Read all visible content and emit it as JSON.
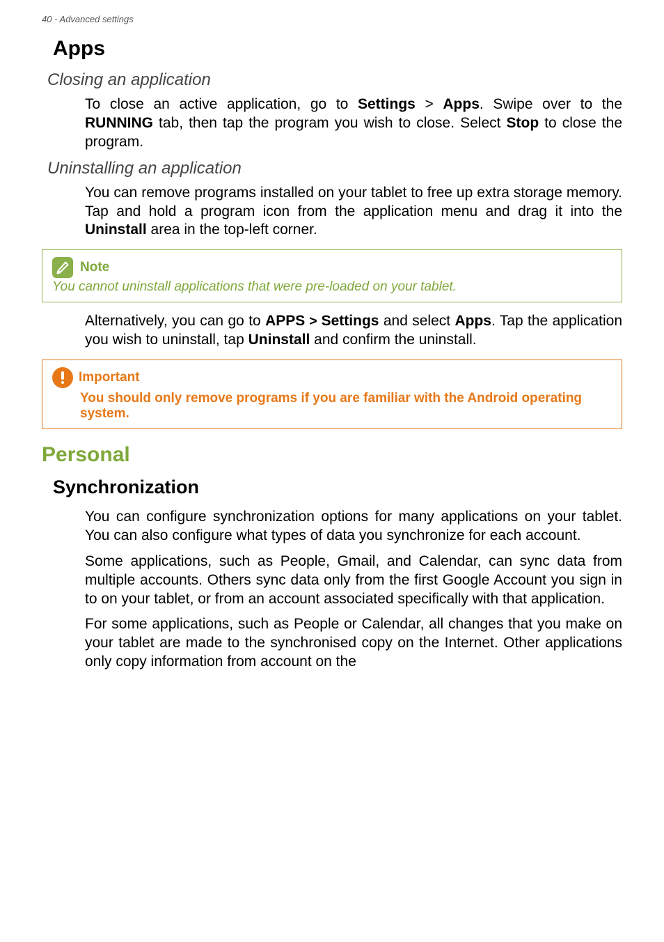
{
  "header": "40 - Advanced settings",
  "apps": {
    "title": "Apps",
    "closing": {
      "heading": "Closing an application",
      "p1_a": "To close an active application, go to ",
      "p1_settings": "Settings",
      "p1_gt": " > ",
      "p1_apps": "Apps",
      "p1_b": ". Swipe over to the ",
      "p1_running": "RUNNING",
      "p1_c": " tab, then tap the program you wish to close. Select ",
      "p1_stop": "Stop",
      "p1_d": " to close the program."
    },
    "uninstalling": {
      "heading": "Uninstalling an application",
      "p1_a": "You can remove programs installed on your tablet to free up extra storage memory. Tap and hold a program icon from the application menu and drag it into the ",
      "p1_uninstall": "Uninstall",
      "p1_b": " area in the top-left corner.",
      "note_label": "Note",
      "note_body": "You cannot uninstall applications that were pre-loaded on your tablet.",
      "p2_a": "Alternatively, you can go to ",
      "p2_apps": "APPS",
      "p2_gt": " > ",
      "p2_settings": "Settings",
      "p2_b": " and select ",
      "p2_apps2": "Apps",
      "p2_c": ". Tap the application you wish to uninstall, tap ",
      "p2_uninstall": "Uninstall",
      "p2_d": " and confirm the uninstall.",
      "imp_label": "Important",
      "imp_body": "You should only remove programs if you are familiar with the Android operating system."
    }
  },
  "personal": {
    "title": "Personal",
    "sync": {
      "heading": "Synchronization",
      "p1": "You can configure synchronization options for many applications on your tablet. You can also configure what types of data you synchronize for each account.",
      "p2": "Some applications, such as People, Gmail, and Calendar, can sync data from multiple accounts. Others sync data only from the first Google Account you sign in to on your tablet, or from an account associated specifically with that application.",
      "p3": "For some applications, such as People or Calendar, all changes that you make on your tablet are made to the synchronised copy on the Internet. Other applications only copy information from account on the"
    }
  }
}
